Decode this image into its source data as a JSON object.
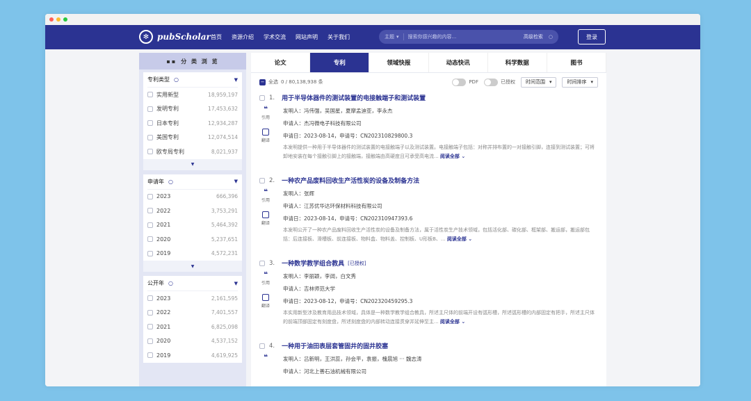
{
  "colors": {
    "brand": "#2b3392",
    "background": "#7ec3ea"
  },
  "nav": {
    "logo": "pubScholar",
    "links": [
      "首页",
      "资源介绍",
      "学术交流",
      "网站声明",
      "关于我们"
    ],
    "search": {
      "scope": "主题",
      "placeholder": "搜索你感兴趣的内容...",
      "advanced": "高级检索"
    },
    "login": "登录"
  },
  "sidebar": {
    "title": "分 类 浏 览",
    "facets": [
      {
        "title": "专利类型",
        "items": [
          {
            "label": "实用新型",
            "count": "18,959,197"
          },
          {
            "label": "发明专利",
            "count": "17,453,632"
          },
          {
            "label": "日本专利",
            "count": "12,934,287"
          },
          {
            "label": "美国专利",
            "count": "12,074,514"
          },
          {
            "label": "欧专局专利",
            "count": "8,021,937"
          }
        ]
      },
      {
        "title": "申请年",
        "items": [
          {
            "label": "2023",
            "count": "666,396"
          },
          {
            "label": "2022",
            "count": "3,753,291"
          },
          {
            "label": "2021",
            "count": "5,464,392"
          },
          {
            "label": "2020",
            "count": "5,237,651"
          },
          {
            "label": "2019",
            "count": "4,572,231"
          }
        ]
      },
      {
        "title": "公开年",
        "items": [
          {
            "label": "2023",
            "count": "2,161,595"
          },
          {
            "label": "2022",
            "count": "7,401,557"
          },
          {
            "label": "2021",
            "count": "6,825,098"
          },
          {
            "label": "2020",
            "count": "4,537,152"
          },
          {
            "label": "2019",
            "count": "4,619,925"
          }
        ]
      }
    ]
  },
  "tabs": [
    "论文",
    "专利",
    "领域快报",
    "动态快讯",
    "科学数据",
    "图书"
  ],
  "toolbar": {
    "select_all": "全选",
    "count": "0 / 80,138,938 条",
    "pdf": "PDF",
    "authorized": "已授权",
    "range": "时间范围",
    "sort": "时间排序"
  },
  "side_actions": {
    "cite": "引用",
    "translate": "翻译"
  },
  "results": [
    {
      "num": "1.",
      "title": "用于半导体器件的测试装置的电接触端子和测试装置",
      "inventors": "发明人：冯伟强，吴国星，夏摩孟迪亚，李永杰",
      "applicant": "申请人：杰冯微电子科技有限公司",
      "meta": "申请日：2023-08-14，申请号：CN202310829800.3",
      "abstract": "本发明提供一种用于半导体器件的测试装置的电接触端子以及测试装置。电接触端子包括：对称并排布置的一对接触引脚，连接到测试装置；可将卸地安装在每个接触引脚上的接触端，接触端由高硬度且可承受高电流...",
      "more": "阅读全部 ⌄"
    },
    {
      "num": "2.",
      "title": "一种农产品废料回收生产活性炭的设备及制备方法",
      "inventors": "发明人：张辉",
      "applicant": "申请人：江苏优华达环保材料科技有限公司",
      "meta": "申请日：2023-08-14，申请号：CN202310947393.6",
      "abstract": "本发明公开了一种农产品废料回收生产活性炭的设备及制备方法，属于活性炭生产技术领域，包括活化部、碳化部、框架部、搬运部，搬运部包括：后连接板、滑槽板、前连接板、物料盒、物料盖、控制板、U形板B、...",
      "more": "阅读全部 ⌄"
    },
    {
      "num": "3.",
      "title": "一种数学教学组合教具",
      "tag": "[已授权]",
      "inventors": "发明人：李丽颖，李阔，白文秀",
      "applicant": "申请人：吉林师范大学",
      "meta": "申请日：2023-08-12，申请号：CN202320459295.3",
      "abstract": "本实用新型涉及教育用品技术领域，具体是一种数学教学组合教具，所述主尺体的前端开设有弧形槽，所述弧形槽的内部固定有把手，所述主尺体的前端顶部固定有刻度盘，所述刻度盘的内部转动连接贯穿并延伸至主...",
      "more": "阅读全部 ⌄"
    },
    {
      "num": "4.",
      "title": "一种用于油田表层套管固井的固井胶塞",
      "inventors": "发明人：吕新明，王洪蕊，孙会平，袁振，槐晨旭 ··· 魏志涛",
      "applicant": "申请人：河北上善石油机械有限公司",
      "meta": "",
      "abstract": "",
      "more": ""
    }
  ]
}
